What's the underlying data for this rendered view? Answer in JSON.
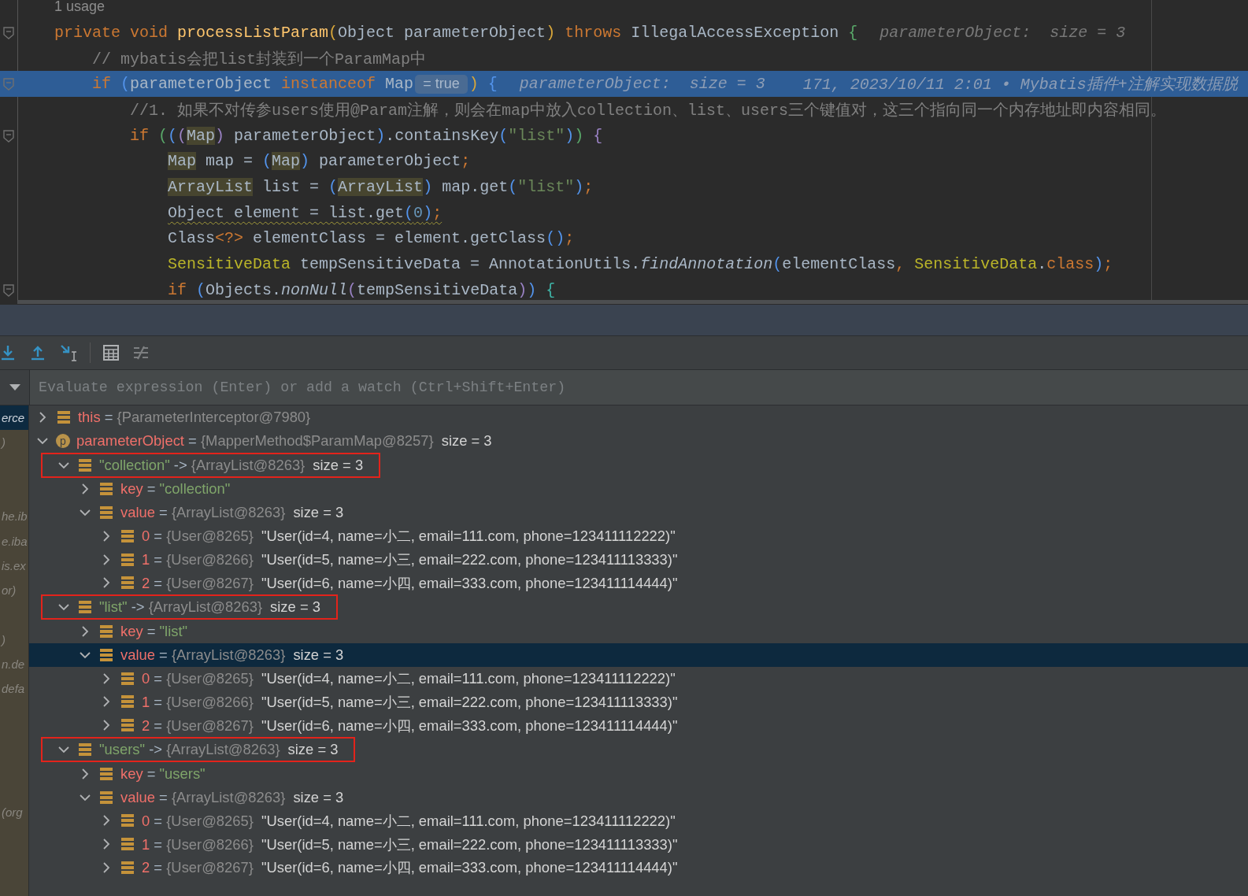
{
  "editor": {
    "usages": "1 usage",
    "lines": [
      {
        "fold": true,
        "current": false,
        "warning": false,
        "segments": [
          {
            "kind": "kw",
            "text": "private void "
          },
          {
            "kind": "decl",
            "text": "processListParam"
          },
          {
            "kind": "py",
            "text": "("
          },
          {
            "kind": "plain",
            "text": "Object parameterObject"
          },
          {
            "kind": "py",
            "text": ")"
          },
          {
            "kind": "kw",
            "text": " throws "
          },
          {
            "kind": "plain",
            "text": "IllegalAccessException "
          },
          {
            "kind": "pg",
            "text": "{"
          }
        ],
        "hints": [
          {
            "kind": "inlay",
            "text": "parameterObject:  size = 3"
          }
        ]
      },
      {
        "fold": false,
        "current": false,
        "warning": false,
        "segments": [
          {
            "kind": "comment",
            "text": "    // mybatis会把list封装到一个ParamMap中"
          }
        ]
      },
      {
        "fold": true,
        "current": true,
        "warning": false,
        "segments": [
          {
            "kind": "kw",
            "text": "    if "
          },
          {
            "kind": "pb",
            "text": "("
          },
          {
            "kind": "plain",
            "text": "parameterObject "
          },
          {
            "kind": "kw",
            "text": "instanceof "
          },
          {
            "kind": "plain",
            "text": "Map"
          },
          {
            "kind": "value",
            "text": "= true"
          },
          {
            "kind": "py",
            "text": ") "
          },
          {
            "kind": "pb",
            "text": "{"
          }
        ],
        "hints": [
          {
            "kind": "inlay",
            "text": "parameterObject:  size = 3"
          },
          {
            "kind": "blame",
            "text": "171, 2023/10/11 2:01 • Mybatis插件+注解实现数据脱"
          }
        ]
      },
      {
        "fold": false,
        "current": false,
        "warning": false,
        "segments": [
          {
            "kind": "comment",
            "text": "        //1. 如果不对传参users使用@Param注解，则会在map中放入collection、list、users三个键值对，这三个指向同一个内存地址即内容相同。"
          }
        ]
      },
      {
        "fold": true,
        "current": false,
        "warning": false,
        "segments": [
          {
            "kind": "kw",
            "text": "        if "
          },
          {
            "kind": "pg",
            "text": "("
          },
          {
            "kind": "pb",
            "text": "("
          },
          {
            "kind": "pp",
            "text": "("
          },
          {
            "kind": "type",
            "text": "Map"
          },
          {
            "kind": "pp",
            "text": ")"
          },
          {
            "kind": "plain",
            "text": " parameterObject"
          },
          {
            "kind": "pb",
            "text": ")"
          },
          {
            "kind": "plain",
            "text": ".containsKey"
          },
          {
            "kind": "pb",
            "text": "("
          },
          {
            "kind": "str",
            "text": "\"list\""
          },
          {
            "kind": "pb",
            "text": ")"
          },
          {
            "kind": "pg",
            "text": ") "
          },
          {
            "kind": "pp",
            "text": "{"
          }
        ]
      },
      {
        "fold": false,
        "current": false,
        "warning": false,
        "segments": [
          {
            "kind": "type",
            "text": "            Map"
          },
          {
            "kind": "plain",
            "text": " map = "
          },
          {
            "kind": "pb",
            "text": "("
          },
          {
            "kind": "type",
            "text": "Map"
          },
          {
            "kind": "pb",
            "text": ")"
          },
          {
            "kind": "plain",
            "text": " parameterObject"
          },
          {
            "kind": "kw",
            "text": ";"
          }
        ]
      },
      {
        "fold": false,
        "current": false,
        "warning": false,
        "segments": [
          {
            "kind": "type",
            "text": "            ArrayList"
          },
          {
            "kind": "plain",
            "text": " list = "
          },
          {
            "kind": "pb",
            "text": "("
          },
          {
            "kind": "type",
            "text": "ArrayList"
          },
          {
            "kind": "pb",
            "text": ")"
          },
          {
            "kind": "plain",
            "text": " map.get"
          },
          {
            "kind": "pb",
            "text": "("
          },
          {
            "kind": "str",
            "text": "\"list\""
          },
          {
            "kind": "pb",
            "text": ")"
          },
          {
            "kind": "kw",
            "text": ";"
          }
        ]
      },
      {
        "fold": false,
        "current": false,
        "warning": true,
        "segments": [
          {
            "kind": "plain",
            "text": "            Object element = list.get"
          },
          {
            "kind": "pb",
            "text": "("
          },
          {
            "kind": "num",
            "text": "0"
          },
          {
            "kind": "pb",
            "text": ")"
          },
          {
            "kind": "kw",
            "text": ";"
          }
        ]
      },
      {
        "fold": false,
        "current": false,
        "warning": false,
        "segments": [
          {
            "kind": "plain",
            "text": "            Class"
          },
          {
            "kind": "kw",
            "text": "<?>"
          },
          {
            "kind": "plain",
            "text": " elementClass = element.getClass"
          },
          {
            "kind": "pb",
            "text": "()"
          },
          {
            "kind": "kw",
            "text": ";"
          }
        ]
      },
      {
        "fold": false,
        "current": false,
        "warning": false,
        "segments": [
          {
            "kind": "sens",
            "text": "            SensitiveData"
          },
          {
            "kind": "plain",
            "text": " tempSensitiveData = AnnotationUtils."
          },
          {
            "kind": "italic",
            "text": "findAnnotation"
          },
          {
            "kind": "pb",
            "text": "("
          },
          {
            "kind": "plain",
            "text": "elementClass"
          },
          {
            "kind": "kw",
            "text": ", "
          },
          {
            "kind": "sens",
            "text": "SensitiveData"
          },
          {
            "kind": "plain",
            "text": "."
          },
          {
            "kind": "kw",
            "text": "class"
          },
          {
            "kind": "pb",
            "text": ")"
          },
          {
            "kind": "kw",
            "text": ";"
          }
        ]
      },
      {
        "fold": true,
        "current": false,
        "warning": false,
        "segments": [
          {
            "kind": "kw",
            "text": "            if "
          },
          {
            "kind": "pb",
            "text": "("
          },
          {
            "kind": "plain",
            "text": "Objects."
          },
          {
            "kind": "italic",
            "text": "nonNull"
          },
          {
            "kind": "pp",
            "text": "("
          },
          {
            "kind": "plain",
            "text": "tempSensitiveData"
          },
          {
            "kind": "pp",
            "text": ")"
          },
          {
            "kind": "pb",
            "text": ") "
          },
          {
            "kind": "pt",
            "text": "{"
          }
        ]
      }
    ]
  },
  "debugger": {
    "toolbar": [
      {
        "kind": "step-into"
      },
      {
        "kind": "step-out"
      },
      {
        "kind": "run-to-cursor"
      },
      {
        "kind": "separator"
      },
      {
        "kind": "evaluate"
      },
      {
        "kind": "trace"
      }
    ],
    "evaluate": {
      "placeholder": "Evaluate expression (Enter) or add a watch (Ctrl+Shift+Enter)"
    },
    "frames": [
      {
        "kind": "frame",
        "text": "erce",
        "selected": true
      },
      {
        "kind": "frame",
        "text": ")",
        "selected": false
      },
      {
        "kind": "blank"
      },
      {
        "kind": "blank"
      },
      {
        "kind": "frame",
        "text": "he.ib",
        "selected": false
      },
      {
        "kind": "frame",
        "text": "e.iba",
        "selected": false
      },
      {
        "kind": "frame",
        "text": "is.ex",
        "selected": false
      },
      {
        "kind": "frame",
        "text": "or)",
        "selected": false
      },
      {
        "kind": "blank"
      },
      {
        "kind": "frame",
        "text": ")",
        "selected": false
      },
      {
        "kind": "frame",
        "text": "n.de",
        "selected": false
      },
      {
        "kind": "frame",
        "text": "defa",
        "selected": false
      },
      {
        "kind": "blank"
      },
      {
        "kind": "blank"
      },
      {
        "kind": "blank"
      },
      {
        "kind": "blank"
      },
      {
        "kind": "frame",
        "text": "(org",
        "selected": false
      }
    ],
    "variables": [
      {
        "kind": "field",
        "name": "this",
        "op": "=",
        "ref": "{ParameterInterceptor@7980}",
        "expanded": false,
        "selected": false,
        "flagged": false
      },
      {
        "kind": "param",
        "letter": "p",
        "name": "parameterObject",
        "op": "=",
        "ref": "{MapperMethod$ParamMap@8257}",
        "detail": "size = 3",
        "expanded": true,
        "selected": false,
        "flagged": false,
        "children": [
          {
            "kind": "field",
            "map_key": "\"collection\"",
            "op": "->",
            "ref": "{ArrayList@8263}",
            "detail": "size = 3",
            "expanded": true,
            "selected": false,
            "flagged": true,
            "children": [
              {
                "kind": "field",
                "name": "key",
                "op": "=",
                "string": "\"collection\"",
                "expanded": false,
                "selected": false,
                "flagged": false
              },
              {
                "kind": "field",
                "name": "value",
                "op": "=",
                "ref": "{ArrayList@8263}",
                "detail": "size = 3",
                "expanded": true,
                "selected": false,
                "flagged": false,
                "children": [
                  {
                    "kind": "field",
                    "name": "0",
                    "op": "=",
                    "ref": "{User@8265}",
                    "detail": "\"User(id=4, name=小二, email=111.com, phone=123411112222)\"",
                    "expanded": false,
                    "selected": false,
                    "flagged": false
                  },
                  {
                    "kind": "field",
                    "name": "1",
                    "op": "=",
                    "ref": "{User@8266}",
                    "detail": "\"User(id=5, name=小三, email=222.com, phone=123411113333)\"",
                    "expanded": false,
                    "selected": false,
                    "flagged": false
                  },
                  {
                    "kind": "field",
                    "name": "2",
                    "op": "=",
                    "ref": "{User@8267}",
                    "detail": "\"User(id=6, name=小四, email=333.com, phone=123411114444)\"",
                    "expanded": false,
                    "selected": false,
                    "flagged": false
                  }
                ]
              }
            ]
          },
          {
            "kind": "field",
            "map_key": "\"list\"",
            "op": "->",
            "ref": "{ArrayList@8263}",
            "detail": "size = 3",
            "expanded": true,
            "selected": false,
            "flagged": true,
            "children": [
              {
                "kind": "field",
                "name": "key",
                "op": "=",
                "string": "\"list\"",
                "expanded": false,
                "selected": false,
                "flagged": false
              },
              {
                "kind": "field",
                "name": "value",
                "op": "=",
                "ref": "{ArrayList@8263}",
                "detail": "size = 3",
                "expanded": true,
                "selected": true,
                "flagged": false,
                "children": [
                  {
                    "kind": "field",
                    "name": "0",
                    "op": "=",
                    "ref": "{User@8265}",
                    "detail": "\"User(id=4, name=小二, email=111.com, phone=123411112222)\"",
                    "expanded": false,
                    "selected": false,
                    "flagged": false
                  },
                  {
                    "kind": "field",
                    "name": "1",
                    "op": "=",
                    "ref": "{User@8266}",
                    "detail": "\"User(id=5, name=小三, email=222.com, phone=123411113333)\"",
                    "expanded": false,
                    "selected": false,
                    "flagged": false
                  },
                  {
                    "kind": "field",
                    "name": "2",
                    "op": "=",
                    "ref": "{User@8267}",
                    "detail": "\"User(id=6, name=小四, email=333.com, phone=123411114444)\"",
                    "expanded": false,
                    "selected": false,
                    "flagged": false
                  }
                ]
              }
            ]
          },
          {
            "kind": "field",
            "map_key": "\"users\"",
            "op": "->",
            "ref": "{ArrayList@8263}",
            "detail": "size = 3",
            "expanded": true,
            "selected": false,
            "flagged": true,
            "children": [
              {
                "kind": "field",
                "name": "key",
                "op": "=",
                "string": "\"users\"",
                "expanded": false,
                "selected": false,
                "flagged": false
              },
              {
                "kind": "field",
                "name": "value",
                "op": "=",
                "ref": "{ArrayList@8263}",
                "detail": "size = 3",
                "expanded": true,
                "selected": false,
                "flagged": false,
                "children": [
                  {
                    "kind": "field",
                    "name": "0",
                    "op": "=",
                    "ref": "{User@8265}",
                    "detail": "\"User(id=4, name=小二, email=111.com, phone=123411112222)\"",
                    "expanded": false,
                    "selected": false,
                    "flagged": false
                  },
                  {
                    "kind": "field",
                    "name": "1",
                    "op": "=",
                    "ref": "{User@8266}",
                    "detail": "\"User(id=5, name=小三, email=222.com, phone=123411113333)\"",
                    "expanded": false,
                    "selected": false,
                    "flagged": false
                  },
                  {
                    "kind": "field",
                    "name": "2",
                    "op": "=",
                    "ref": "{User@8267}",
                    "detail": "\"User(id=6, name=小四, email=333.com, phone=123411114444)\"",
                    "expanded": false,
                    "selected": false,
                    "flagged": false
                  }
                ]
              }
            ]
          }
        ]
      }
    ]
  }
}
